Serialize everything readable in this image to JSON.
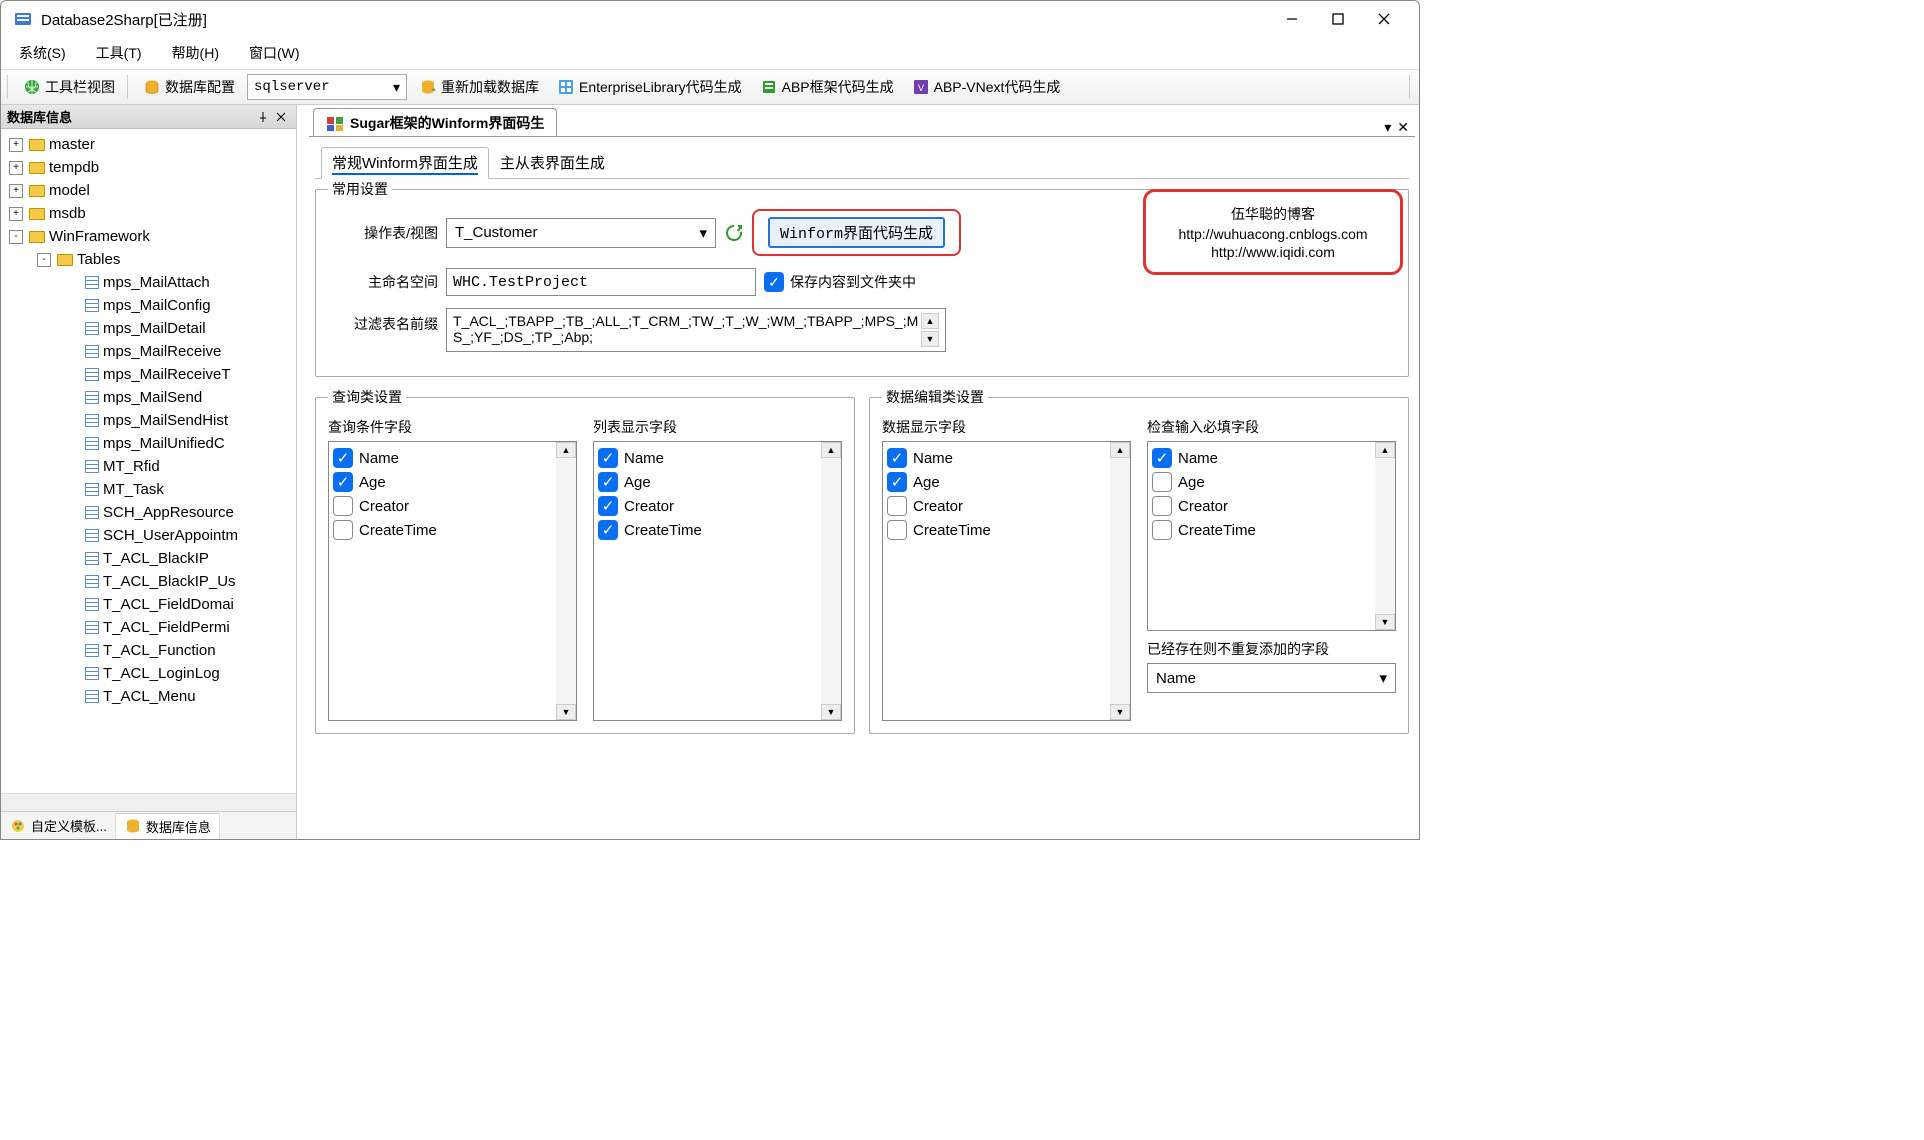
{
  "window": {
    "title": "Database2Sharp[已注册]"
  },
  "menu": {
    "system": "系统(S)",
    "tools": "工具(T)",
    "help": "帮助(H)",
    "window": "窗口(W)"
  },
  "toolbar": {
    "toolbarView": "工具栏视图",
    "dbConfig": "数据库配置",
    "dbTypeSelected": "sqlserver",
    "reload": "重新加载数据库",
    "entLib": "EnterpriseLibrary代码生成",
    "abp": "ABP框架代码生成",
    "abpVnext": "ABP-VNext代码生成"
  },
  "sidebar": {
    "title": "数据库信息",
    "nodes": [
      {
        "label": "master",
        "type": "db",
        "expander": "+",
        "indent": 0
      },
      {
        "label": "tempdb",
        "type": "db",
        "expander": "+",
        "indent": 0
      },
      {
        "label": "model",
        "type": "db",
        "expander": "+",
        "indent": 0
      },
      {
        "label": "msdb",
        "type": "db",
        "expander": "+",
        "indent": 0
      },
      {
        "label": "WinFramework",
        "type": "db",
        "expander": "-",
        "indent": 0
      },
      {
        "label": "Tables",
        "type": "folder",
        "expander": "-",
        "indent": 1
      },
      {
        "label": "mps_MailAttach",
        "type": "table",
        "indent": 2
      },
      {
        "label": "mps_MailConfig",
        "type": "table",
        "indent": 2
      },
      {
        "label": "mps_MailDetail",
        "type": "table",
        "indent": 2
      },
      {
        "label": "mps_MailReceive",
        "type": "table",
        "indent": 2
      },
      {
        "label": "mps_MailReceiveT",
        "type": "table",
        "indent": 2
      },
      {
        "label": "mps_MailSend",
        "type": "table",
        "indent": 2
      },
      {
        "label": "mps_MailSendHist",
        "type": "table",
        "indent": 2
      },
      {
        "label": "mps_MailUnifiedC",
        "type": "table",
        "indent": 2
      },
      {
        "label": "MT_Rfid",
        "type": "table",
        "indent": 2
      },
      {
        "label": "MT_Task",
        "type": "table",
        "indent": 2
      },
      {
        "label": "SCH_AppResource",
        "type": "table",
        "indent": 2
      },
      {
        "label": "SCH_UserAppointm",
        "type": "table",
        "indent": 2
      },
      {
        "label": "T_ACL_BlackIP",
        "type": "table",
        "indent": 2
      },
      {
        "label": "T_ACL_BlackIP_Us",
        "type": "table",
        "indent": 2
      },
      {
        "label": "T_ACL_FieldDomai",
        "type": "table",
        "indent": 2
      },
      {
        "label": "T_ACL_FieldPermi",
        "type": "table",
        "indent": 2
      },
      {
        "label": "T_ACL_Function",
        "type": "table",
        "indent": 2
      },
      {
        "label": "T_ACL_LoginLog",
        "type": "table",
        "indent": 2
      },
      {
        "label": "T_ACL_Menu",
        "type": "table",
        "indent": 2
      }
    ],
    "bottomTabs": {
      "custom": "自定义模板...",
      "dbInfo": "数据库信息"
    }
  },
  "doc": {
    "tabTitle": "Sugar框架的Winform界面码生",
    "subTabs": {
      "normal": "常规Winform界面生成",
      "masterDetail": "主从表界面生成"
    },
    "blog": {
      "title": "伍华聪的博客",
      "link1": "http://wuhuacong.cnblogs.com",
      "link2": "http://www.iqidi.com"
    }
  },
  "settings": {
    "groupTitle": "常用设置",
    "tableLabel": "操作表/视图",
    "tableValue": "T_Customer",
    "genButton": "Winform界面代码生成",
    "nsLabel": "主命名空间",
    "nsValue": "WHC.TestProject",
    "saveToFolder": "保存内容到文件夹中",
    "filterLabel": "过滤表名前缀",
    "filterValue": "T_ACL_;TBAPP_;TB_;ALL_;T_CRM_;TW_;T_;W_;WM_;TBAPP_;MPS_;MS_;YF_;DS_;TP_;Abp;"
  },
  "query": {
    "groupTitle": "查询类设置",
    "condLabel": "查询条件字段",
    "listLabel": "列表显示字段",
    "condFields": [
      {
        "name": "Name",
        "checked": true
      },
      {
        "name": "Age",
        "checked": true
      },
      {
        "name": "Creator",
        "checked": false
      },
      {
        "name": "CreateTime",
        "checked": false
      }
    ],
    "listFields": [
      {
        "name": "Name",
        "checked": true
      },
      {
        "name": "Age",
        "checked": true
      },
      {
        "name": "Creator",
        "checked": true
      },
      {
        "name": "CreateTime",
        "checked": true
      }
    ]
  },
  "edit": {
    "groupTitle": "数据编辑类设置",
    "dataLabel": "数据显示字段",
    "requiredLabel": "检查输入必填字段",
    "noRepeatLabel": "已经存在则不重复添加的字段",
    "noRepeatSelected": "Name",
    "dataFields": [
      {
        "name": "Name",
        "checked": true
      },
      {
        "name": "Age",
        "checked": true
      },
      {
        "name": "Creator",
        "checked": false
      },
      {
        "name": "CreateTime",
        "checked": false
      }
    ],
    "requiredFields": [
      {
        "name": "Name",
        "checked": true
      },
      {
        "name": "Age",
        "checked": false
      },
      {
        "name": "Creator",
        "checked": false
      },
      {
        "name": "CreateTime",
        "checked": false
      }
    ]
  }
}
